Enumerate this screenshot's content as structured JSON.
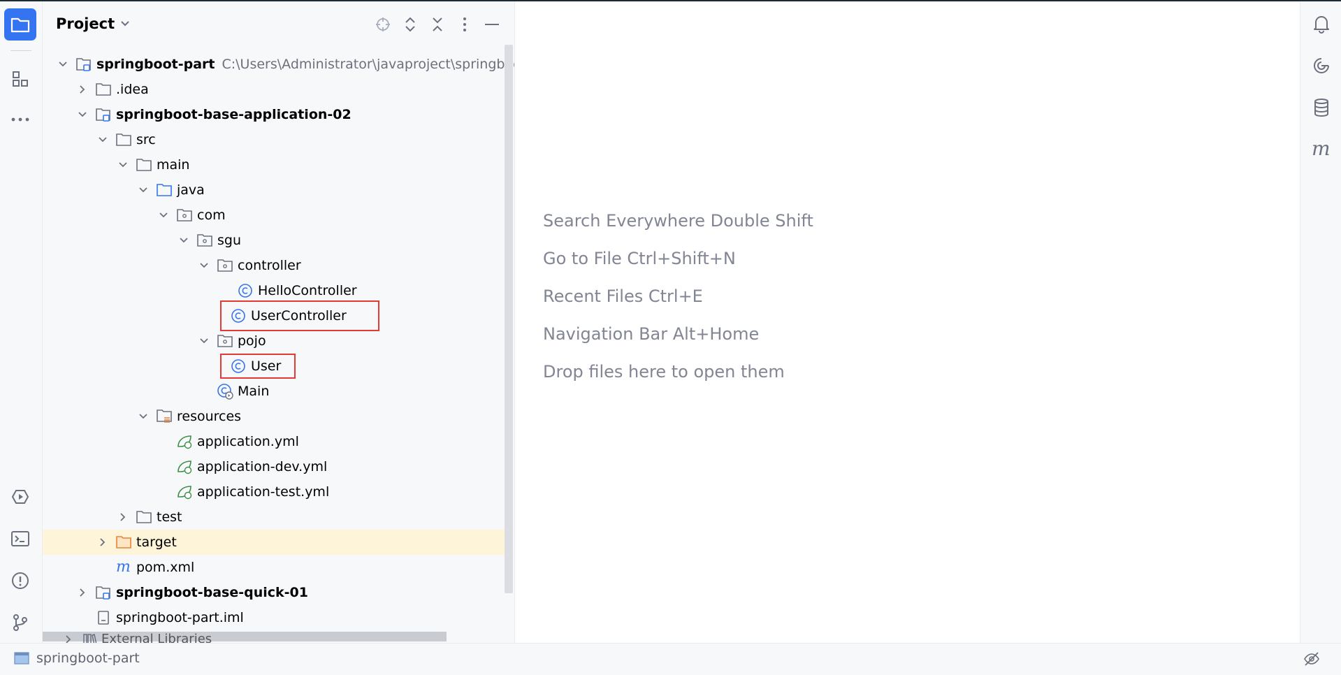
{
  "panel": {
    "title": "Project"
  },
  "tree": [
    {
      "id": "root",
      "label": "springboot-part",
      "path": "C:\\Users\\Administrator\\javaproject\\springboot",
      "bold": true
    },
    {
      "id": "idea",
      "label": ".idea"
    },
    {
      "id": "app02",
      "label": "springboot-base-application-02",
      "bold": true
    },
    {
      "id": "src",
      "label": "src"
    },
    {
      "id": "main",
      "label": "main"
    },
    {
      "id": "java",
      "label": "java"
    },
    {
      "id": "com",
      "label": "com"
    },
    {
      "id": "sgu",
      "label": "sgu"
    },
    {
      "id": "controller",
      "label": "controller"
    },
    {
      "id": "hello",
      "label": "HelloController"
    },
    {
      "id": "userctrl",
      "label": "UserController"
    },
    {
      "id": "pojo",
      "label": "pojo"
    },
    {
      "id": "user",
      "label": "User"
    },
    {
      "id": "mainclass",
      "label": "Main"
    },
    {
      "id": "resources",
      "label": "resources"
    },
    {
      "id": "appyml",
      "label": "application.yml"
    },
    {
      "id": "appdev",
      "label": "application-dev.yml"
    },
    {
      "id": "apptest",
      "label": "application-test.yml"
    },
    {
      "id": "test",
      "label": "test"
    },
    {
      "id": "target",
      "label": "target"
    },
    {
      "id": "pom",
      "label": "pom.xml"
    },
    {
      "id": "quick01",
      "label": "springboot-base-quick-01",
      "bold": true
    },
    {
      "id": "iml",
      "label": "springboot-part.iml"
    }
  ],
  "external_libraries": "External Libraries",
  "editor_hints": [
    "Search Everywhere Double Shift",
    "Go to File Ctrl+Shift+N",
    "Recent Files Ctrl+E",
    "Navigation Bar Alt+Home",
    "Drop files here to open them"
  ],
  "status": {
    "project": "springboot-part"
  },
  "colors": {
    "accent": "#3574f0",
    "highlight_box": "#e53935",
    "selected_row": "#fdf4d9"
  }
}
